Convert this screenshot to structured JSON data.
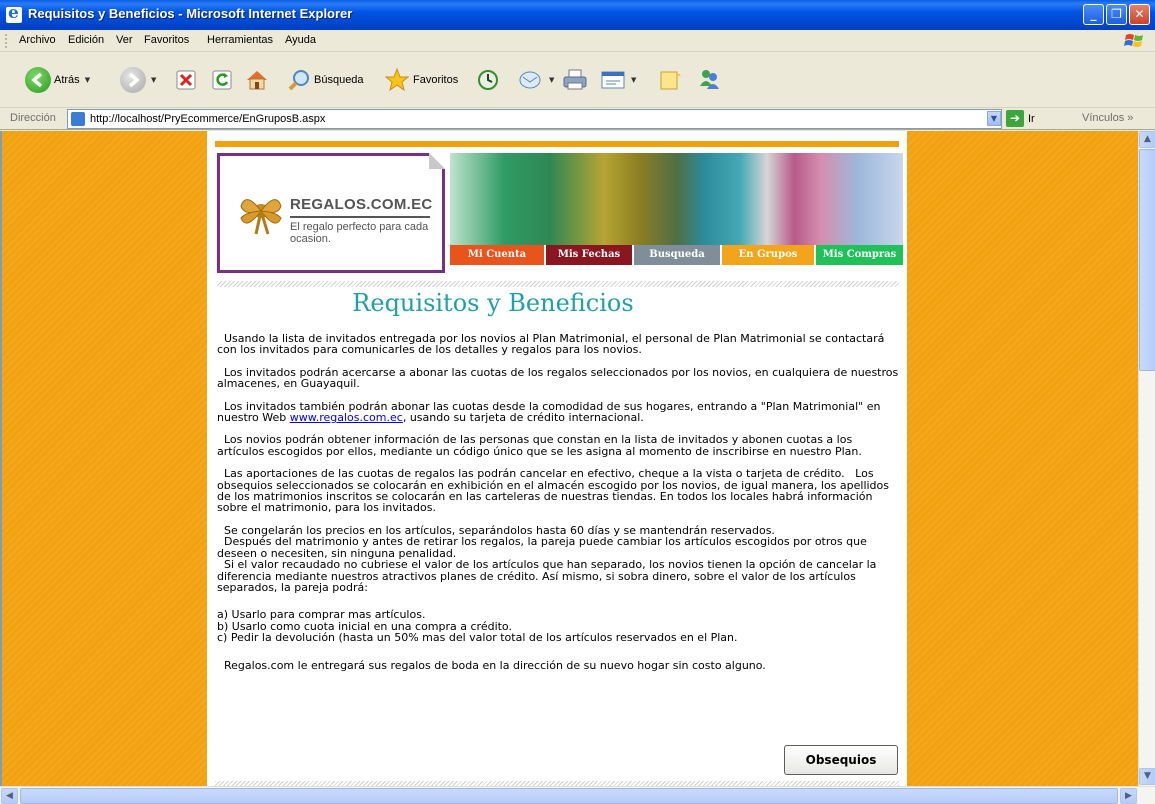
{
  "window": {
    "title": "Requisitos y Beneficios - Microsoft Internet Explorer"
  },
  "menu": [
    "Archivo",
    "Edición",
    "Ver",
    "Favoritos",
    "Herramientas",
    "Ayuda"
  ],
  "toolbar": {
    "back_label": "Atrás",
    "search_label": "Búsqueda",
    "favorites_label": "Favoritos"
  },
  "address": {
    "label": "Dirección",
    "url": "http://localhost/PryEcommerce/EnGruposB.aspx",
    "go_label": "Ir",
    "links_label": "Vínculos"
  },
  "logo": {
    "name": "REGALOS.COM.EC",
    "tagline": "El regalo perfecto para cada ocasion."
  },
  "tabs": [
    {
      "label": "Mi Cuenta",
      "color": "#e8541b"
    },
    {
      "label": "Mis Fechas",
      "color": "#8a1622"
    },
    {
      "label": "Busqueda",
      "color": "#7f8e99"
    },
    {
      "label": "En Grupos",
      "color": "#f2a51a"
    },
    {
      "label": "Mis Compras",
      "color": "#1fc158"
    }
  ],
  "page": {
    "heading": "Requisitos y Beneficios",
    "p1": "  Usando la lista de invitados entregada por los novios al Plan Matrimonial, el personal de Plan Matrimonial se contactará con los invitados para comunicarles de los detalles y regalos para los novios.",
    "p2": "  Los invitados podrán acercarse a abonar las cuotas de los regalos seleccionados por los novios, en cualquiera de nuestros almacenes, en Guayaquil.",
    "p3_before": "  Los invitados también podrán abonar las cuotas desde la comodidad de sus hogares, entrando a \"Plan Matrimonial\" en nuestro Web ",
    "p3_link": "www.regalos.com.ec",
    "p3_after": ", usando su tarjeta de crédito internacional.",
    "p4": "  Los novios podrán obtener información de las personas que constan en la lista de invitados y abonen cuotas a los artículos escogidos por ellos, mediante un código único que se les asigna al momento de inscribirse en nuestro Plan.",
    "p5": "  Las aportaciones de las cuotas de regalos las podrán cancelar en efectivo, cheque a la vista o tarjeta de crédito.   Los obsequios seleccionados se colocarán en exhibición en el almacén escogido por los novios, de igual manera, los apellidos de los matrimonios inscritos se colocarán en las carteleras de nuestras tiendas. En todos los locales habrá información sobre el matrimonio, para los invitados.",
    "p6a": "  Se congelarán los precios en los artículos, separándolos hasta 60 días y se mantendrán reservados.",
    "p6b": "  Después del matrimonio y antes de retirar los regalos, la pareja puede cambiar los artículos escogidos por otros que deseen o necesiten, sin ninguna penalidad.",
    "p6c": "  Si el valor recaudado no cubriese el valor de los artículos que han separado, los novios tienen la opción de cancelar la diferencia mediante nuestros atractivos planes de crédito. Así mismo, si sobra dinero, sobre el valor de los artículos separados, la pareja podrá:",
    "la": "a) Usarlo para comprar mas artículos.",
    "lb": "b) Usarlo como cuota inicial en una compra a crédito.",
    "lc": "c) Pedir la devolución (hasta un 50% mas del valor total de los artículos reservados en el Plan.",
    "p7": "  Regalos.com le entregará sus regalos de boda en la dirección de su nuevo hogar sin costo alguno.",
    "button": "Obsequios"
  }
}
